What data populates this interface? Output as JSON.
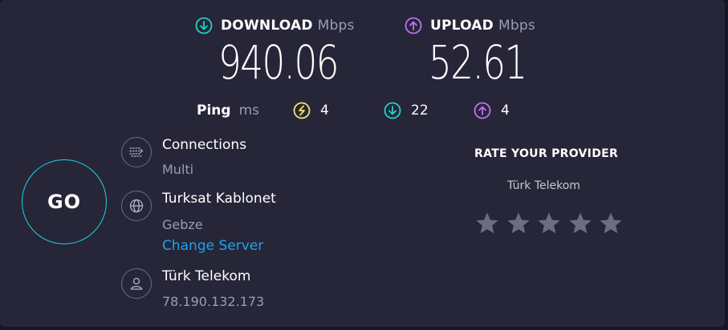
{
  "download": {
    "label": "DOWNLOAD",
    "unit": "Mbps",
    "value": "940.06"
  },
  "upload": {
    "label": "UPLOAD",
    "unit": "Mbps",
    "value": "52.61"
  },
  "ping": {
    "label": "Ping",
    "unit": "ms",
    "idle": "4",
    "download": "22",
    "upload": "4"
  },
  "go_label": "GO",
  "connections": {
    "title": "Connections",
    "value": "Multi"
  },
  "server": {
    "name": "Turksat Kablonet",
    "location": "Gebze",
    "change_label": "Change Server"
  },
  "provider": {
    "name": "Türk Telekom",
    "ip": "78.190.132.173"
  },
  "rate": {
    "title": "RATE YOUR PROVIDER",
    "provider": "Türk Telekom",
    "stars": 5
  },
  "colors": {
    "download_accent": "#1fd3c9",
    "upload_accent": "#bf71f2",
    "ping_accent": "#f5e36a",
    "link": "#1fa3ec"
  }
}
